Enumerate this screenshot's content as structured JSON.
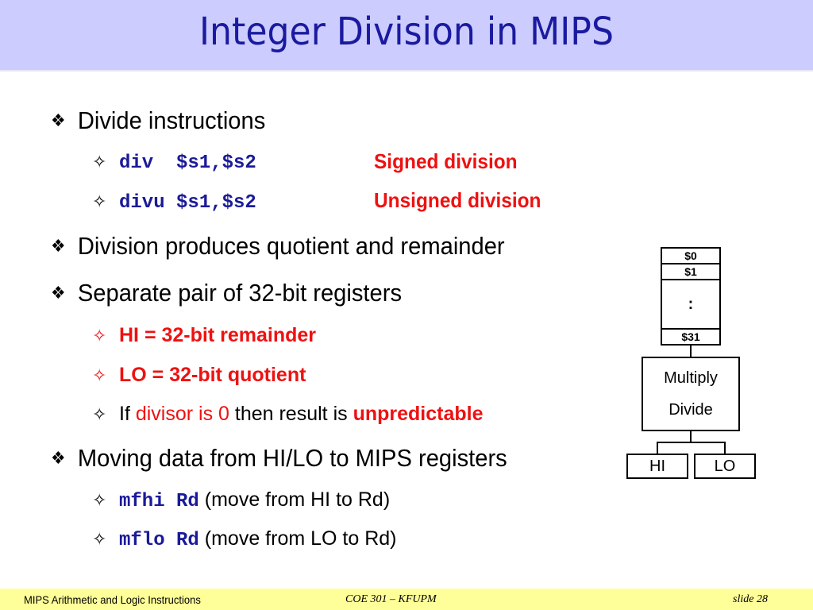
{
  "title": "Integer Division in MIPS",
  "bullets": {
    "main_bullet_icon": "❖",
    "sub_bullet_icon": "✧",
    "b1": {
      "text": "Divide instructions",
      "items": [
        {
          "code": "div  $s1,$s2",
          "note": "Signed division"
        },
        {
          "code": "divu $s1,$s2",
          "note": "Unsigned division"
        }
      ]
    },
    "b2": {
      "text": "Division produces quotient and remainder"
    },
    "b3": {
      "text": "Separate pair of 32-bit registers",
      "items": [
        {
          "text": "HI = 32-bit remainder"
        },
        {
          "text": "LO = 32-bit quotient"
        },
        {
          "prefix": "If ",
          "red1": "divisor is 0",
          "middle": " then result is ",
          "red2": "unpredictable"
        }
      ]
    },
    "b4": {
      "text": "Moving data from HI/LO to MIPS registers",
      "items": [
        {
          "code": "mfhi Rd",
          "desc": " (move from HI to Rd)"
        },
        {
          "code": "mflo Rd",
          "desc": " (move from LO to Rd)"
        }
      ]
    }
  },
  "diagram": {
    "registers": [
      "$0",
      "$1",
      ":",
      "$31"
    ],
    "unit_line1": "Multiply",
    "unit_line2": "Divide",
    "hi": "HI",
    "lo": "LO"
  },
  "footer": {
    "left": "MIPS Arithmetic and Logic Instructions",
    "center": "COE 301 – KFUPM",
    "right": "slide 28"
  },
  "colors": {
    "title_bg": "#ccccff",
    "title_text": "#1a1aa0",
    "code": "#1a1a99",
    "emphasis": "#ee1111",
    "footer_bg": "#ffff99"
  }
}
